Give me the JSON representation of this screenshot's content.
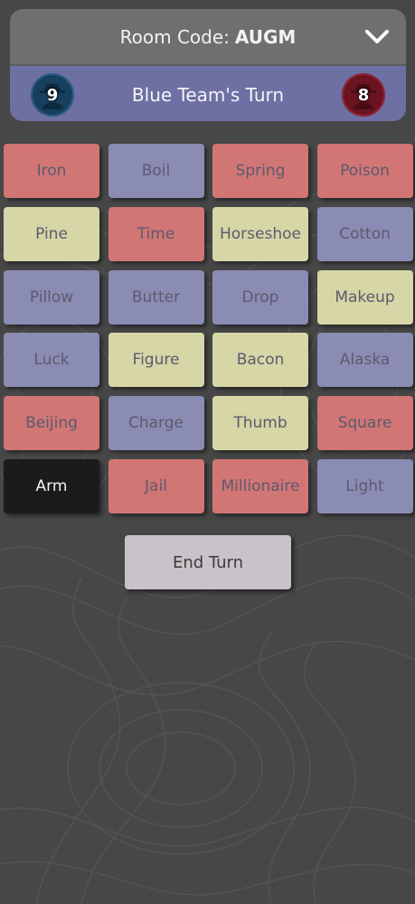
{
  "header": {
    "room_label": "Room Code:",
    "room_code": "AUGM",
    "menu_icon": "chevron-down-icon",
    "turn_text": "Blue Team's Turn",
    "blue_remaining": "9",
    "red_remaining": "8"
  },
  "colors": {
    "red": "#d17675",
    "blue": "#8b8cb4",
    "neutral": "#d6d6a6",
    "assassin": "#1b1b1b",
    "turn_bar": "#6e6fa3"
  },
  "cards": [
    {
      "word": "Iron",
      "team": "red"
    },
    {
      "word": "Boil",
      "team": "blue"
    },
    {
      "word": "Spring",
      "team": "red"
    },
    {
      "word": "Poison",
      "team": "red"
    },
    {
      "word": "Pine",
      "team": "neutral"
    },
    {
      "word": "Time",
      "team": "red"
    },
    {
      "word": "Horseshoe",
      "team": "neutral"
    },
    {
      "word": "Cotton",
      "team": "blue"
    },
    {
      "word": "Pillow",
      "team": "blue"
    },
    {
      "word": "Butter",
      "team": "blue"
    },
    {
      "word": "Drop",
      "team": "blue"
    },
    {
      "word": "Makeup",
      "team": "neutral"
    },
    {
      "word": "Luck",
      "team": "blue"
    },
    {
      "word": "Figure",
      "team": "neutral"
    },
    {
      "word": "Bacon",
      "team": "neutral"
    },
    {
      "word": "Alaska",
      "team": "blue"
    },
    {
      "word": "Beijing",
      "team": "red"
    },
    {
      "word": "Charge",
      "team": "blue"
    },
    {
      "word": "Thumb",
      "team": "neutral"
    },
    {
      "word": "Square",
      "team": "red"
    },
    {
      "word": "Arm",
      "team": "assassin"
    },
    {
      "word": "Jail",
      "team": "red"
    },
    {
      "word": "Millionaire",
      "team": "red"
    },
    {
      "word": "Light",
      "team": "blue"
    }
  ],
  "footer": {
    "end_turn_label": "End Turn"
  }
}
